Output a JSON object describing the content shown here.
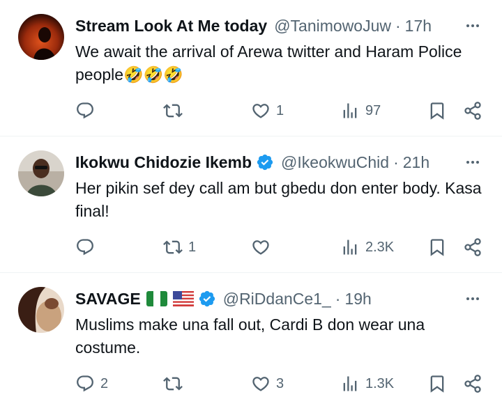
{
  "tweets": [
    {
      "name": "Stream Look At Me today",
      "handle": "@TanimowoJuw",
      "separator": "·",
      "time": "17h",
      "text": "We await the arrival of Arewa twitter and Haram Police people🤣🤣🤣",
      "replies": "",
      "retweets": "",
      "likes": "1",
      "views": "97",
      "verified": false
    },
    {
      "name": "Ikokwu Chidozie Ikemb",
      "handle": "@IkeokwuChid",
      "separator": "·",
      "time": "21h",
      "text": "Her pikin sef dey call am but gbedu don enter body. Kasa final!",
      "replies": "",
      "retweets": "1",
      "likes": "",
      "views": "2.3K",
      "verified": true
    },
    {
      "name": "SAVAGE",
      "handle": "@RiDdanCe1_",
      "separator": "·",
      "time": "19h",
      "text": "Muslims make una fall out, Cardi B don wear una costume.",
      "replies": "2",
      "retweets": "",
      "likes": "3",
      "views": "1.3K",
      "verified": true,
      "flags": [
        "nigeria-flag",
        "us-flag"
      ]
    }
  ],
  "colors": {
    "text": "#0f1419",
    "secondary": "#536471",
    "verified": "#1d9bf0",
    "divider": "#eff3f4"
  },
  "icons": [
    "reply-icon",
    "retweet-icon",
    "like-icon",
    "views-icon",
    "bookmark-icon",
    "share-icon",
    "more-icon",
    "verified-badge-icon"
  ]
}
